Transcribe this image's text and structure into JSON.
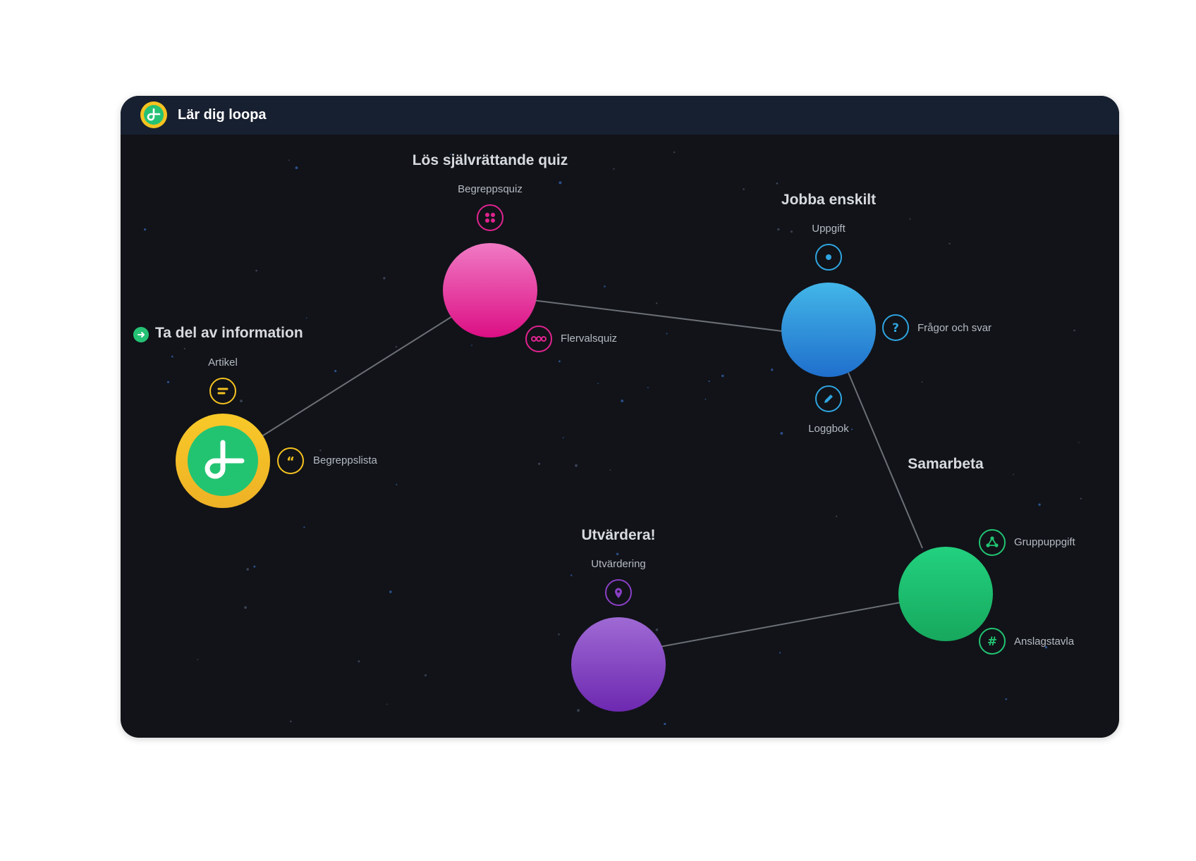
{
  "app": {
    "title": "Lär dig loopa",
    "logo_icon": "loopa-logo-icon"
  },
  "colors": {
    "window_bg": "#111318",
    "title_bar_bg": "#172030",
    "yellow": "#f5c220",
    "green": "#22c472",
    "pink": "#e0238f",
    "blue": "#2d8fe0",
    "purple": "#8a3fc4",
    "link_line": "#6b6f76"
  },
  "sections": {
    "information": {
      "title": "Ta del av information",
      "current_marker_icon": "arrow-right-circle-icon",
      "activities": {
        "artikel": {
          "label": "Artikel",
          "icon": "text-lines-icon"
        },
        "begreppslista": {
          "label": "Begreppslista",
          "icon": "quote-icon"
        }
      }
    },
    "quiz": {
      "title": "Lös självrättande quiz",
      "activities": {
        "begreppsquiz": {
          "label": "Begreppsquiz",
          "icon": "four-dots-icon"
        },
        "flervalsquiz": {
          "label": "Flervalsquiz",
          "icon": "three-dots-icon"
        }
      }
    },
    "enskilt": {
      "title": "Jobba enskilt",
      "activities": {
        "uppgift": {
          "label": "Uppgift",
          "icon": "dot-icon"
        },
        "fragor": {
          "label": "Frågor och svar",
          "icon": "question-icon"
        },
        "loggbok": {
          "label": "Loggbok",
          "icon": "pencil-icon"
        }
      }
    },
    "samarbeta": {
      "title": "Samarbeta",
      "activities": {
        "gruppuppgift": {
          "label": "Gruppuppgift",
          "icon": "group-nodes-icon"
        },
        "anslagstavla": {
          "label": "Anslagstavla",
          "icon": "hash-icon"
        }
      }
    },
    "utvardera": {
      "title": "Utvärdera!",
      "activities": {
        "utvardering": {
          "label": "Utvärdering",
          "icon": "location-pin-icon"
        }
      }
    }
  }
}
